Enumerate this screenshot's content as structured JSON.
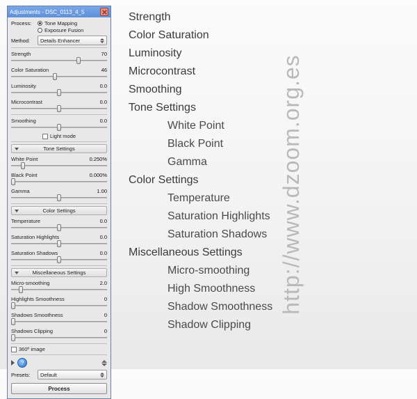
{
  "watermark": "http://www.dzoom.org.es",
  "outline": {
    "items": [
      {
        "t": "Strength",
        "sub": false
      },
      {
        "t": "Color Saturation",
        "sub": false
      },
      {
        "t": "Luminosity",
        "sub": false
      },
      {
        "t": "Microcontrast",
        "sub": false
      },
      {
        "t": "Smoothing",
        "sub": false
      },
      {
        "t": "Tone Settings",
        "sub": false
      },
      {
        "t": "White Point",
        "sub": true
      },
      {
        "t": "Black Point",
        "sub": true
      },
      {
        "t": "Gamma",
        "sub": true
      },
      {
        "t": "Color Settings",
        "sub": false
      },
      {
        "t": "Temperature",
        "sub": true
      },
      {
        "t": "Saturation Highlights",
        "sub": true
      },
      {
        "t": "Saturation Shadows",
        "sub": true
      },
      {
        "t": "Miscellaneous Settings",
        "sub": false
      },
      {
        "t": "Micro-smoothing",
        "sub": true
      },
      {
        "t": "High Smoothness",
        "sub": true
      },
      {
        "t": "Shadow Smoothness",
        "sub": true
      },
      {
        "t": "Shadow Clipping",
        "sub": true
      }
    ]
  },
  "panel": {
    "title": "Adjustments - DSC_0113_4_5",
    "process_label": "Process:",
    "process_opts": {
      "tone": "Tone Mapping",
      "exp": "Exposure Fusion",
      "selected": "tone"
    },
    "method_label": "Method:",
    "method_value": "Details Enhancer",
    "sliders_top": [
      {
        "name": "Strength",
        "val": "70",
        "pos": 70
      },
      {
        "name": "Color Saturation",
        "val": "46",
        "pos": 46
      },
      {
        "name": "Luminosity",
        "val": "0.0",
        "pos": 50
      },
      {
        "name": "Microcontrast",
        "val": "0.0",
        "pos": 50
      }
    ],
    "smoothing": {
      "name": "Smoothing",
      "val": "0.0",
      "pos": 50
    },
    "light_mode": "Light mode",
    "sections": [
      {
        "title": "Tone Settings",
        "items": [
          {
            "name": "White Point",
            "val": "0.250%",
            "pos": 12
          },
          {
            "name": "Black Point",
            "val": "0.000%",
            "pos": 2
          },
          {
            "name": "Gamma",
            "val": "1.00",
            "pos": 50
          }
        ]
      },
      {
        "title": "Color Settings",
        "items": [
          {
            "name": "Temperature",
            "val": "0.0",
            "pos": 50
          },
          {
            "name": "Saturation Highlights",
            "val": "0.0",
            "pos": 50
          },
          {
            "name": "Saturation Shadows",
            "val": "0.0",
            "pos": 50
          }
        ]
      },
      {
        "title": "Miscellaneous Settings",
        "items": [
          {
            "name": "Micro-smoothing",
            "val": "2.0",
            "pos": 10
          },
          {
            "name": "Highlights Smoothness",
            "val": "0",
            "pos": 2
          },
          {
            "name": "Shadows Smoothness",
            "val": "0",
            "pos": 2
          },
          {
            "name": "Shadows Clipping",
            "val": "0",
            "pos": 2
          }
        ]
      }
    ],
    "image360": "360º image",
    "presets_label": "Presets:",
    "presets_value": "Default",
    "process_btn": "Process"
  }
}
